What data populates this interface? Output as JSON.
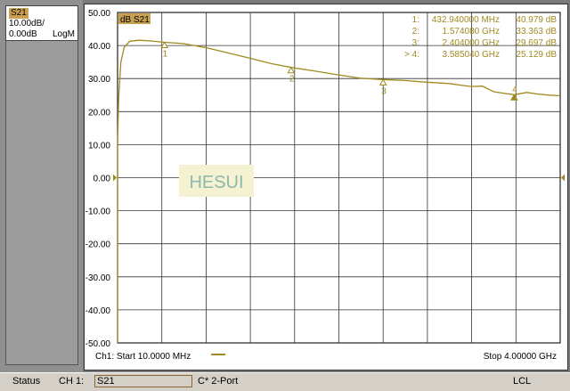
{
  "side_panel": {
    "trace_tag": "S21",
    "scale": "10.00dB/",
    "ref_value": "0.00dB",
    "format": "LogM"
  },
  "plot": {
    "trace_label": "dB S21",
    "watermark": "HESUI",
    "start_label": "Ch1: Start  10.0000 MHz",
    "stop_label": "Stop  4.00000 GHz",
    "trace_color": "#a08a20",
    "marker_color": "#a08a20"
  },
  "markers": [
    {
      "id": "1:",
      "freq": "432.940000 MHz",
      "value": "40.979 dB",
      "num": "1"
    },
    {
      "id": "2:",
      "freq": "1.574080 GHz",
      "value": "33.363 dB",
      "num": "2"
    },
    {
      "id": "3:",
      "freq": "2.404000 GHz",
      "value": "29.697 dB",
      "num": "3"
    },
    {
      "id": "> 4:",
      "freq": "3.585040 GHz",
      "value": "25.129 dB",
      "num": "4"
    }
  ],
  "chart_data": {
    "type": "line",
    "x_unit": "GHz",
    "xlim": [
      0.01,
      4.0
    ],
    "ylim": [
      -50,
      50
    ],
    "yticks": [
      "50.00",
      "40.00",
      "30.00",
      "20.00",
      "10.00",
      "0.00",
      "-10.00",
      "-20.00",
      "-30.00",
      "-40.00",
      "-50.00"
    ],
    "x_divisions": 10,
    "grid": true,
    "series": [
      {
        "points": [
          [
            0.01,
            10
          ],
          [
            0.02,
            24
          ],
          [
            0.04,
            35
          ],
          [
            0.07,
            39.5
          ],
          [
            0.12,
            41.3
          ],
          [
            0.2,
            41.6
          ],
          [
            0.3,
            41.4
          ],
          [
            0.433,
            40.979
          ],
          [
            0.6,
            40.6
          ],
          [
            0.8,
            39.4
          ],
          [
            1.0,
            37.8
          ],
          [
            1.2,
            36.2
          ],
          [
            1.4,
            34.5
          ],
          [
            1.574,
            33.363
          ],
          [
            1.8,
            32.2
          ],
          [
            2.0,
            31.1
          ],
          [
            2.2,
            30.1
          ],
          [
            2.404,
            29.697
          ],
          [
            2.6,
            29.4
          ],
          [
            2.8,
            28.9
          ],
          [
            3.0,
            28.5
          ],
          [
            3.1,
            28.0
          ],
          [
            3.2,
            27.6
          ],
          [
            3.3,
            27.7
          ],
          [
            3.4,
            26.0
          ],
          [
            3.5,
            25.5
          ],
          [
            3.585,
            25.129
          ],
          [
            3.7,
            25.8
          ],
          [
            3.8,
            25.3
          ],
          [
            3.9,
            25.0
          ],
          [
            4.0,
            24.8
          ]
        ]
      }
    ]
  },
  "status_bar": {
    "status": "Status",
    "channel": "CH 1:",
    "param": "S21",
    "cal": "C* 2-Port",
    "lcl": "LCL"
  }
}
